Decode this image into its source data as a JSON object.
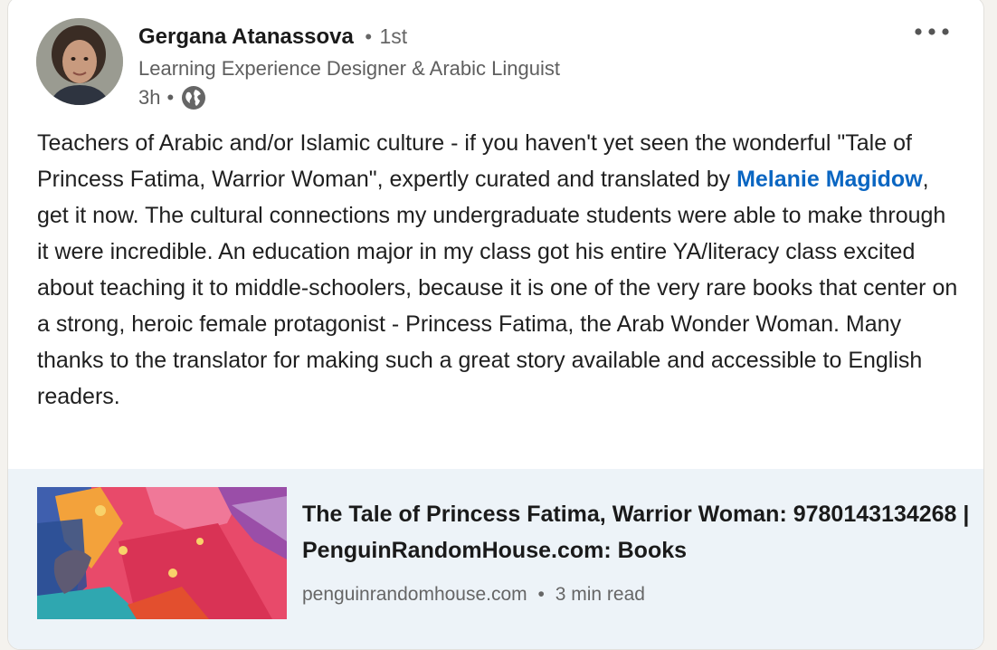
{
  "author": {
    "name": "Gergana Atanassova",
    "separator": "•",
    "connection_degree": "1st",
    "headline": "Learning Experience Designer & Arabic Linguist",
    "time_ago": "3h",
    "visibility_icon": "globe-icon"
  },
  "menu": {
    "icon": "more-options-icon"
  },
  "post": {
    "text_before_mention": "Teachers of Arabic and/or Islamic culture - if you haven't yet seen the wonderful \"Tale of Princess Fatima, Warrior Woman\", expertly curated and translated by ",
    "mention": "Melanie Magidow",
    "text_after_mention": ", get it now. The cultural connections my undergraduate students were able to make through it were incredible. An education major in my class got his entire YA/literacy class excited about teaching it to middle-schoolers, because it is one of the very rare books that center on a strong, heroic female protagonist - Princess Fatima, the Arab Wonder Woman. Many thanks to the translator for making such a great story available and accessible to English readers."
  },
  "link_preview": {
    "title": "The Tale of Princess Fatima, Warrior Woman: 9780143134268 | PenguinRandomHouse.com: Books",
    "domain": "penguinrandomhouse.com",
    "separator": "•",
    "read_time": "3 min read"
  },
  "colors": {
    "mention": "#0a66c2",
    "preview_background": "#edf3f8",
    "secondary_text": "#666666"
  }
}
